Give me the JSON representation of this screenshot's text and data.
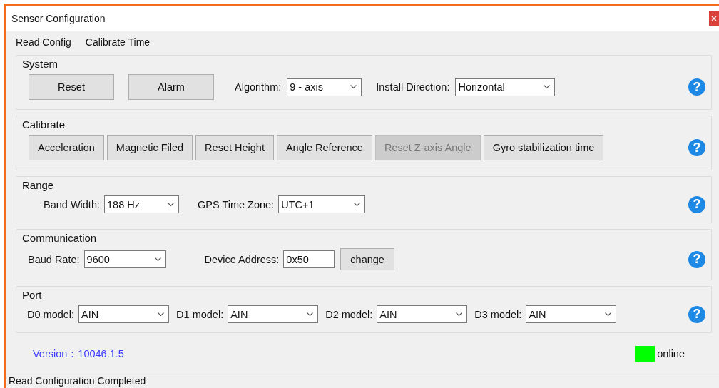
{
  "window": {
    "title": "Sensor Configuration"
  },
  "menu": [
    "Read Config",
    "Calibrate Time"
  ],
  "sections": [
    {
      "title": "System",
      "help": "?",
      "items": [
        {
          "kind": "button",
          "label": "Reset",
          "disabled": false
        },
        {
          "kind": "button",
          "label": "Alarm",
          "disabled": false
        },
        {
          "kind": "select",
          "label": "Algorithm:",
          "value": "9 - axis"
        },
        {
          "kind": "select",
          "label": "Install Direction:",
          "value": "Horizontal"
        }
      ]
    },
    {
      "title": "Calibrate",
      "help": "?",
      "items": [
        {
          "kind": "button",
          "label": "Acceleration",
          "disabled": false
        },
        {
          "kind": "button",
          "label": "Magnetic Filed",
          "disabled": false
        },
        {
          "kind": "button",
          "label": "Reset Height",
          "disabled": false
        },
        {
          "kind": "button",
          "label": "Angle Reference",
          "disabled": false
        },
        {
          "kind": "button",
          "label": "Reset Z-axis Angle",
          "disabled": true
        },
        {
          "kind": "button",
          "label": "Gyro stabilization time",
          "disabled": false
        }
      ]
    },
    {
      "title": "Range",
      "help": "?",
      "items": [
        {
          "kind": "select",
          "label": "Band Width:",
          "value": "188 Hz"
        },
        {
          "kind": "select",
          "label": "GPS Time Zone:",
          "value": "UTC+1"
        }
      ]
    },
    {
      "title": "Communication",
      "help": "?",
      "items": [
        {
          "kind": "select",
          "label": "Baud Rate:",
          "value": "9600"
        },
        {
          "kind": "input",
          "label": "Device Address:",
          "value": "0x50"
        },
        {
          "kind": "button",
          "label": "change",
          "disabled": false
        }
      ]
    },
    {
      "title": "Port",
      "help": "?",
      "items": [
        {
          "kind": "select",
          "label": "D0 model:",
          "value": "AIN"
        },
        {
          "kind": "select",
          "label": "D1 model:",
          "value": "AIN"
        },
        {
          "kind": "select",
          "label": "D2 model:",
          "value": "AIN"
        },
        {
          "kind": "select",
          "label": "D3 model:",
          "value": "AIN"
        }
      ]
    }
  ],
  "version": "Version：10046.1.5",
  "connection": {
    "label": "online",
    "color": "#00ff00"
  },
  "status_bar": "Read Configuration Completed"
}
